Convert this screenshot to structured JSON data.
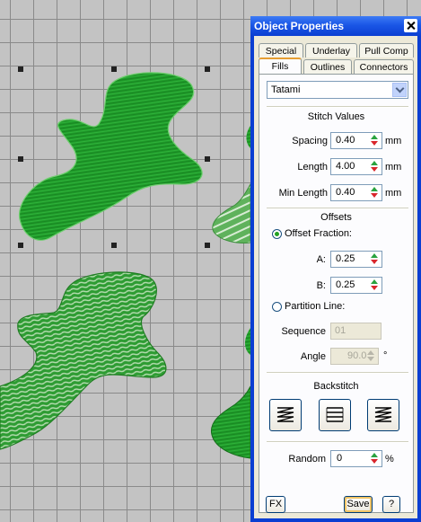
{
  "window": {
    "title": "Object Properties"
  },
  "tabs": {
    "row1": [
      "Special",
      "Underlay",
      "Pull Comp"
    ],
    "row2": [
      "Fills",
      "Outlines",
      "Connectors"
    ],
    "active": "Fills"
  },
  "fill_type": {
    "selected": "Tatami"
  },
  "stitch_values": {
    "heading": "Stitch Values",
    "spacing": {
      "label": "Spacing",
      "value": "0.40",
      "unit": "mm"
    },
    "length": {
      "label": "Length",
      "value": "4.00",
      "unit": "mm"
    },
    "min_length": {
      "label": "Min Length",
      "value": "0.40",
      "unit": "mm"
    }
  },
  "offsets": {
    "heading": "Offsets",
    "offset_fraction": {
      "label": "Offset Fraction:",
      "selected": true
    },
    "a": {
      "label": "A:",
      "value": "0.25"
    },
    "b": {
      "label": "B:",
      "value": "0.25"
    },
    "partition_line": {
      "label": "Partition Line:",
      "selected": false
    },
    "sequence": {
      "label": "Sequence",
      "value": "01"
    },
    "angle": {
      "label": "Angle",
      "value": "90.0",
      "unit": "°"
    }
  },
  "backstitch": {
    "heading": "Backstitch",
    "options": [
      "backstitch-zigzag-left-icon",
      "backstitch-straight-icon",
      "backstitch-zigzag-right-icon"
    ]
  },
  "random": {
    "label": "Random",
    "value": "0",
    "unit": "%"
  },
  "footer": {
    "fx_label": "FX",
    "save_label": "Save",
    "help_label": "?"
  },
  "colors": {
    "titlebar": "#0b3fd2",
    "fill_dark": "#1f9a2a",
    "fill_light": "#7cc27a",
    "panel": "#ece9d8"
  }
}
